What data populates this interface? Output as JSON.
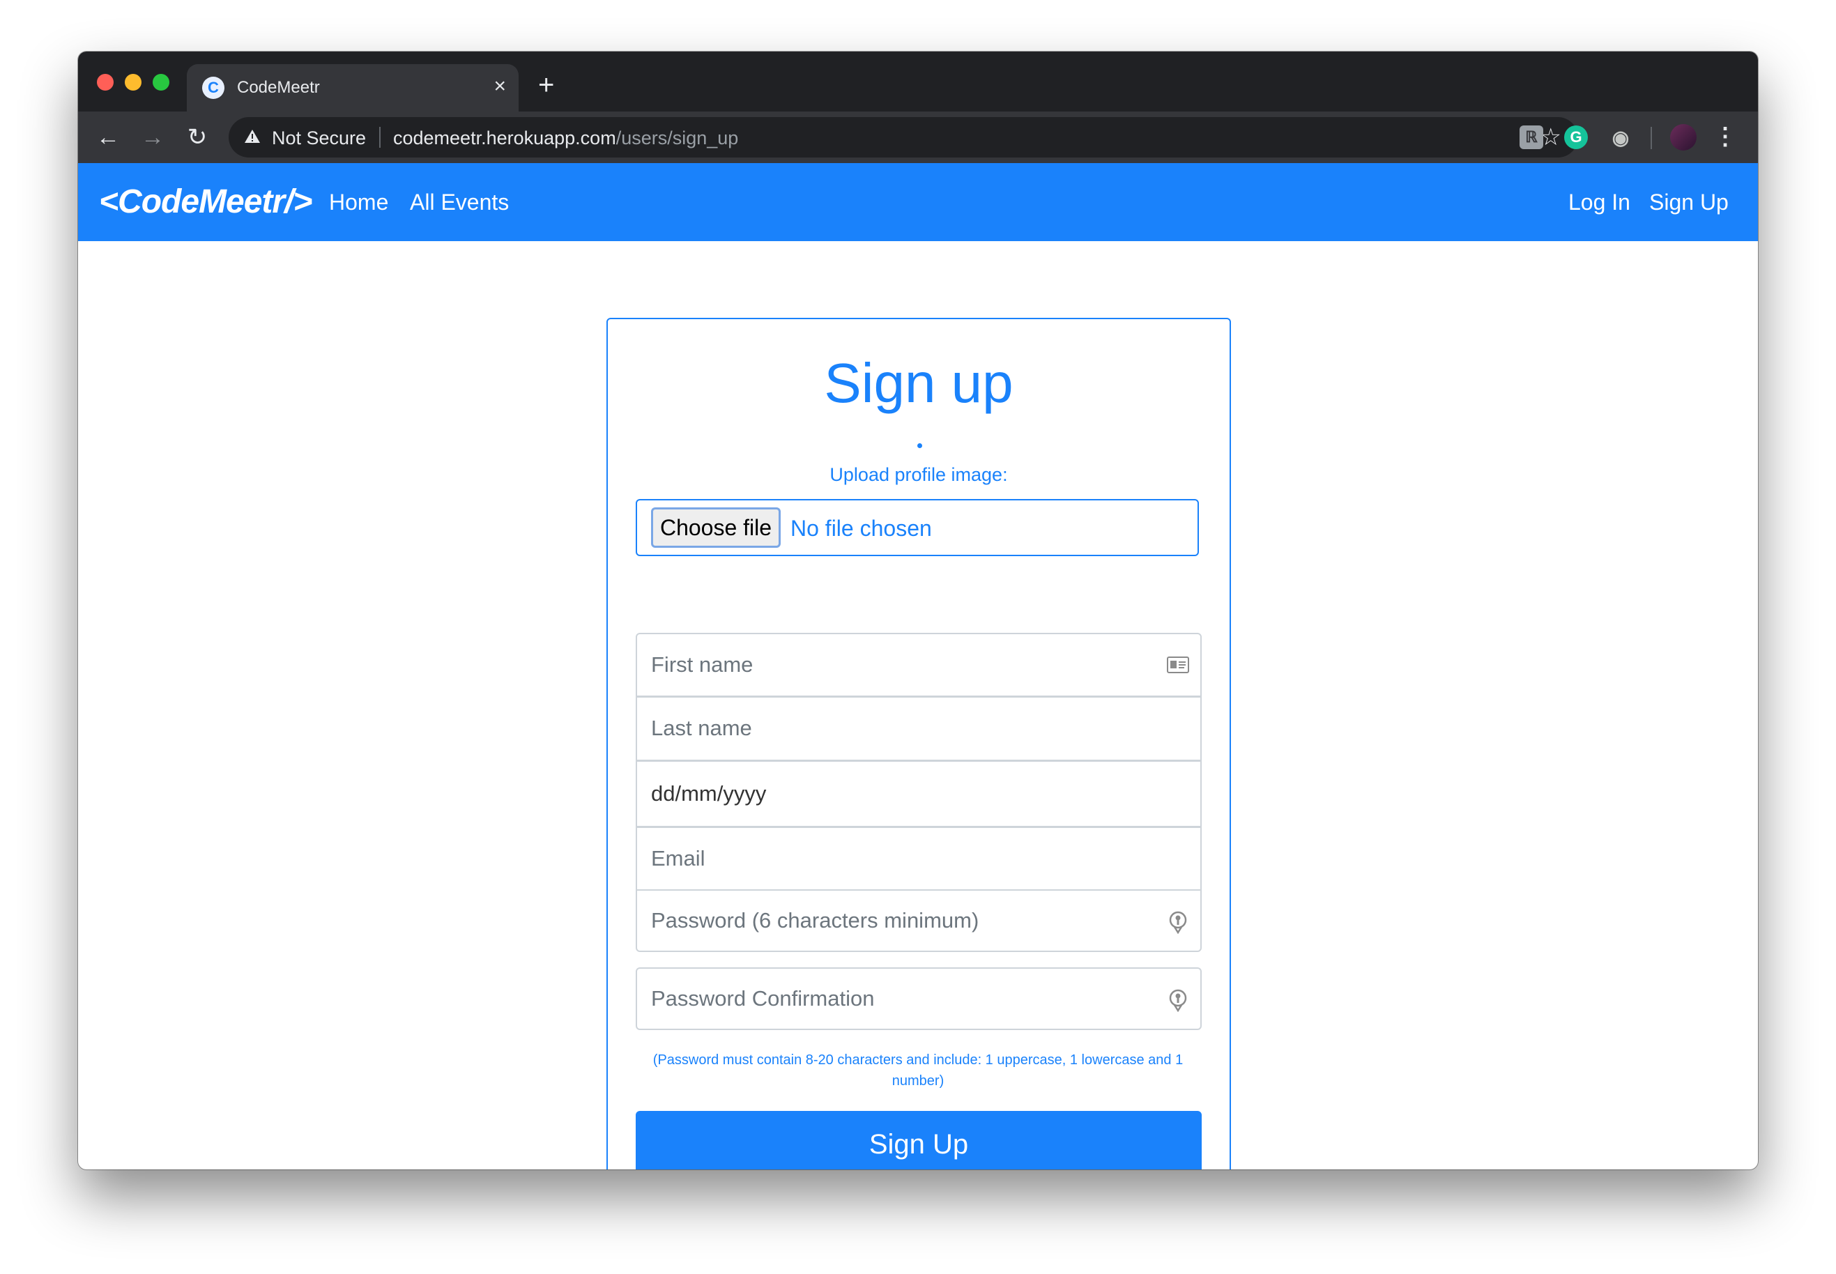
{
  "browser": {
    "tab_title": "CodeMeetr",
    "tab_close": "×",
    "new_tab": "+",
    "security_label": "Not Secure",
    "url_host": "codemeetr.herokuapp.com",
    "url_path": "/users/sign_up"
  },
  "navbar": {
    "brand": "<CodeMeetr/>",
    "links": [
      {
        "label": "Home"
      },
      {
        "label": "All Events"
      }
    ],
    "auth": [
      {
        "label": "Log In"
      },
      {
        "label": "Sign Up"
      }
    ],
    "accent_color": "#1a82fb"
  },
  "form": {
    "title": "Sign up",
    "upload_label": "Upload profile image:",
    "file_button": "Choose file",
    "file_status": "No file chosen",
    "fields": {
      "first_name": "First name",
      "last_name": "Last name",
      "dob": "dd/mm/yyyy",
      "email": "Email",
      "password": "Password (6 characters minimum)",
      "password_confirmation": "Password Confirmation"
    },
    "hint": "(Password must contain 8-20 characters and include: 1 uppercase, 1 lowercase and 1 number)",
    "submit": "Sign Up"
  },
  "icons": {
    "favicon": "codemeetr-favicon-icon",
    "back": "arrow-left-icon",
    "forward": "arrow-right-icon",
    "reload": "reload-icon",
    "warning": "warning-triangle-icon",
    "bookmark": "star-icon",
    "extensions": [
      "extension-icon",
      "grammarly-icon",
      "camera-icon"
    ],
    "profile": "avatar",
    "menu": "kebab-menu-icon",
    "contact_card": "contact-card-icon",
    "password_key": "password-key-icon"
  }
}
